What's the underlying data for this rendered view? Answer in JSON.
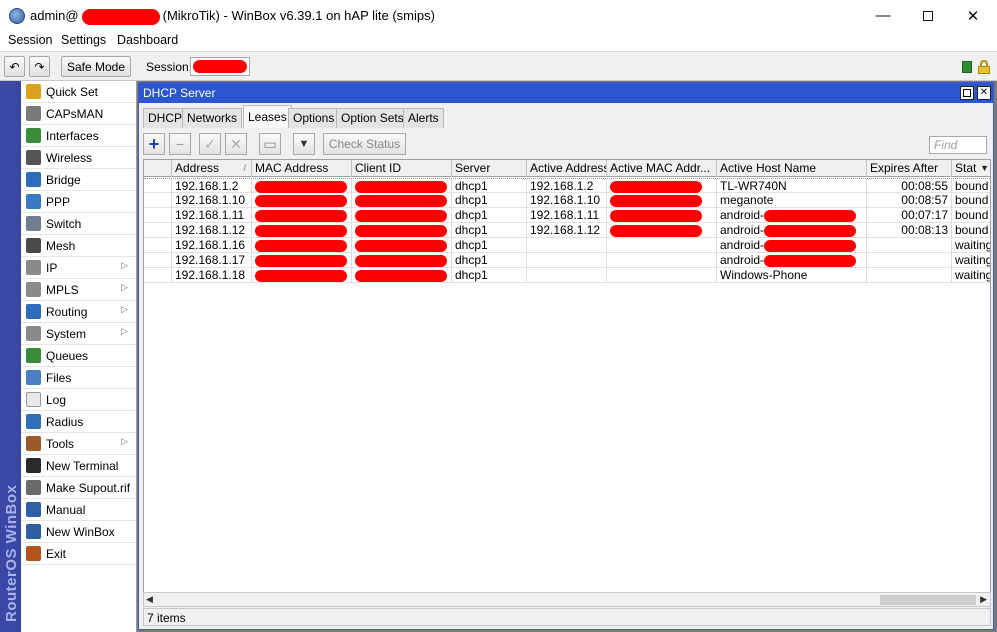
{
  "window": {
    "title_prefix": "admin@",
    "title_suffix": "(MikroTik) - WinBox v6.39.1 on hAP lite (smips)",
    "minimize_glyph": "—",
    "close_glyph": "✕"
  },
  "menu": [
    "Session",
    "Settings",
    "Dashboard"
  ],
  "toolbar": {
    "undo_glyph": "↶",
    "redo_glyph": "↷",
    "safe_mode_label": "Safe Mode",
    "session_label": "Session:"
  },
  "brand": "RouterOS WinBox",
  "sidebar": {
    "items": [
      {
        "label": "Quick Set",
        "icon": "quick-set-icon",
        "color": "#d9a21c",
        "submenu": false
      },
      {
        "label": "CAPsMAN",
        "icon": "capsman-icon",
        "color": "#7a7a7a",
        "submenu": false
      },
      {
        "label": "Interfaces",
        "icon": "interfaces-icon",
        "color": "#3a8c3a",
        "submenu": false
      },
      {
        "label": "Wireless",
        "icon": "wireless-icon",
        "color": "#555555",
        "submenu": false
      },
      {
        "label": "Bridge",
        "icon": "bridge-icon",
        "color": "#2e6bb8",
        "submenu": false
      },
      {
        "label": "PPP",
        "icon": "ppp-icon",
        "color": "#3a79c4",
        "submenu": false
      },
      {
        "label": "Switch",
        "icon": "switch-icon",
        "color": "#6f7f8f",
        "submenu": false
      },
      {
        "label": "Mesh",
        "icon": "mesh-icon",
        "color": "#4a4a4a",
        "submenu": false
      },
      {
        "label": "IP",
        "icon": "ip-icon",
        "color": "#8a8a8a",
        "submenu": true
      },
      {
        "label": "MPLS",
        "icon": "mpls-icon",
        "color": "#8a8a8a",
        "submenu": true
      },
      {
        "label": "Routing",
        "icon": "routing-icon",
        "color": "#2e6bb8",
        "submenu": true
      },
      {
        "label": "System",
        "icon": "system-icon",
        "color": "#8a8a8a",
        "submenu": true
      },
      {
        "label": "Queues",
        "icon": "queues-icon",
        "color": "#3a8c3a",
        "submenu": false
      },
      {
        "label": "Files",
        "icon": "files-icon",
        "color": "#4a7ec2",
        "submenu": false
      },
      {
        "label": "Log",
        "icon": "log-icon",
        "color": "#e8e8e8",
        "submenu": false
      },
      {
        "label": "Radius",
        "icon": "radius-icon",
        "color": "#2f6fb9",
        "submenu": false
      },
      {
        "label": "Tools",
        "icon": "tools-icon",
        "color": "#9a5a2a",
        "submenu": true
      },
      {
        "label": "New Terminal",
        "icon": "terminal-icon",
        "color": "#2a2a2a",
        "submenu": false
      },
      {
        "label": "Make Supout.rif",
        "icon": "supout-icon",
        "color": "#6a6a6a",
        "submenu": false
      },
      {
        "label": "Manual",
        "icon": "manual-icon",
        "color": "#2e5fa8",
        "submenu": false
      },
      {
        "label": "New WinBox",
        "icon": "winbox-icon",
        "color": "#2f5f9e",
        "submenu": false
      },
      {
        "label": "Exit",
        "icon": "exit-icon",
        "color": "#b4541a",
        "submenu": false
      }
    ]
  },
  "dhcp_window": {
    "title": "DHCP Server",
    "tabs": [
      "DHCP",
      "Networks",
      "Leases",
      "Options",
      "Option Sets",
      "Alerts"
    ],
    "active_tab": "Leases",
    "buttons": {
      "add_glyph": "+",
      "remove_glyph": "−",
      "enable_glyph": "✓",
      "disable_glyph": "✕",
      "comment_glyph": "▭",
      "filter_glyph": "▼",
      "check_status_label": "Check Status"
    },
    "find_placeholder": "Find",
    "columns": [
      "Address",
      "MAC Address",
      "Client ID",
      "Server",
      "Active Address",
      "Active MAC Addr...",
      "Active Host Name",
      "Expires After",
      "Stat"
    ],
    "rows": [
      {
        "address": "192.168.1.2",
        "server": "dhcp1",
        "active_address": "192.168.1.2",
        "host": "TL-WR740N",
        "host_redacted": false,
        "expires": "00:08:55",
        "status": "bound",
        "active_mac_redacted": true
      },
      {
        "address": "192.168.1.10",
        "server": "dhcp1",
        "active_address": "192.168.1.10",
        "host": "meganote",
        "host_redacted": false,
        "expires": "00:08:57",
        "status": "bound",
        "active_mac_redacted": true
      },
      {
        "address": "192.168.1.11",
        "server": "dhcp1",
        "active_address": "192.168.1.11",
        "host": "android-",
        "host_redacted": true,
        "expires": "00:07:17",
        "status": "bound",
        "active_mac_redacted": true
      },
      {
        "address": "192.168.1.12",
        "server": "dhcp1",
        "active_address": "192.168.1.12",
        "host": "android-",
        "host_redacted": true,
        "expires": "00:08:13",
        "status": "bound",
        "active_mac_redacted": true
      },
      {
        "address": "192.168.1.16",
        "server": "dhcp1",
        "active_address": "",
        "host": "android-",
        "host_redacted": true,
        "expires": "",
        "status": "waiting",
        "active_mac_redacted": false
      },
      {
        "address": "192.168.1.17",
        "server": "dhcp1",
        "active_address": "",
        "host": "android-",
        "host_redacted": true,
        "expires": "",
        "status": "waiting",
        "active_mac_redacted": false
      },
      {
        "address": "192.168.1.18",
        "server": "dhcp1",
        "active_address": "",
        "host": "Windows-Phone",
        "host_redacted": false,
        "expires": "",
        "status": "waiting",
        "active_mac_redacted": false
      }
    ],
    "status_text": "7 items",
    "redaction_color": "#ff0000"
  }
}
